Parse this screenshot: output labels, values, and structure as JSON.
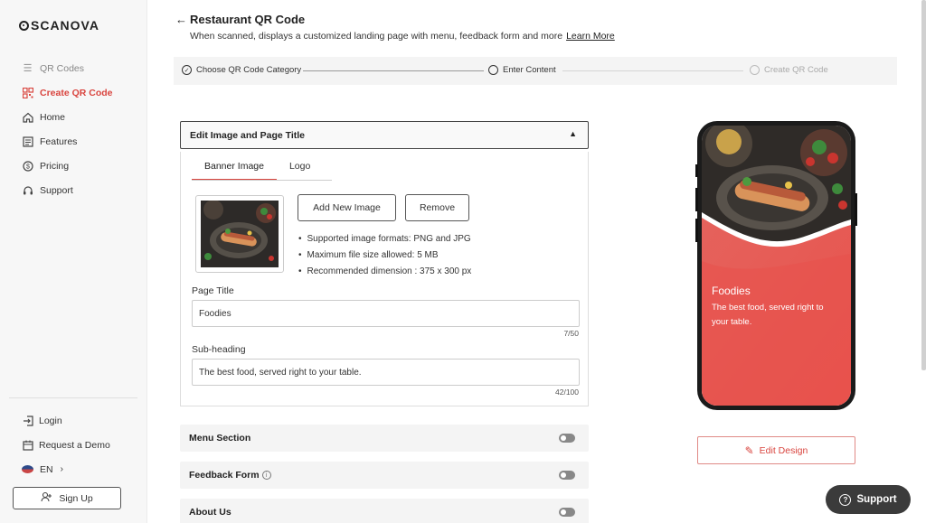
{
  "brand": {
    "logo_text": "SCANOVA"
  },
  "sidebar": {
    "items": [
      {
        "label": "QR Codes",
        "icon": "list-icon"
      },
      {
        "label": "Create QR Code",
        "icon": "qr-grid-icon"
      },
      {
        "label": "Home",
        "icon": "home-icon"
      },
      {
        "label": "Features",
        "icon": "features-icon"
      },
      {
        "label": "Pricing",
        "icon": "pricing-icon"
      },
      {
        "label": "Support",
        "icon": "headset-icon"
      }
    ],
    "bottom": {
      "login": "Login",
      "demo": "Request a Demo",
      "language": "EN",
      "signup": "Sign Up"
    }
  },
  "header": {
    "title": "Restaurant QR Code",
    "subtitle": "When scanned, displays a customized landing page with menu, feedback form and more",
    "learn_more": "Learn More"
  },
  "stepper": {
    "steps": [
      {
        "label": "Choose QR Code Category",
        "state": "done"
      },
      {
        "label": "Enter Content",
        "state": "current"
      },
      {
        "label": "Create QR Code",
        "state": "pending"
      }
    ]
  },
  "editor": {
    "panel_title": "Edit Image and Page Title",
    "tabs": [
      "Banner Image",
      "Logo"
    ],
    "add_image": "Add New Image",
    "remove": "Remove",
    "notes": [
      "Supported image formats: PNG and JPG",
      "Maximum file size allowed: 5 MB",
      "Recommended dimension : 375 x 300 px"
    ],
    "page_title_label": "Page Title",
    "page_title_value": "Foodies",
    "page_title_count": "7/50",
    "subheading_label": "Sub-heading",
    "subheading_value": "The best food, served right to your table.",
    "subheading_count": "42/100"
  },
  "sections": [
    {
      "label": "Menu Section",
      "enabled": false
    },
    {
      "label": "Feedback Form",
      "enabled": false,
      "info": "i"
    },
    {
      "label": "About Us",
      "enabled": false
    }
  ],
  "preview": {
    "title": "Foodies",
    "subtitle": "The best food, served right to your table.",
    "edit_design": "Edit Design",
    "accent_color": "#e8524c"
  },
  "support_label": "Support"
}
